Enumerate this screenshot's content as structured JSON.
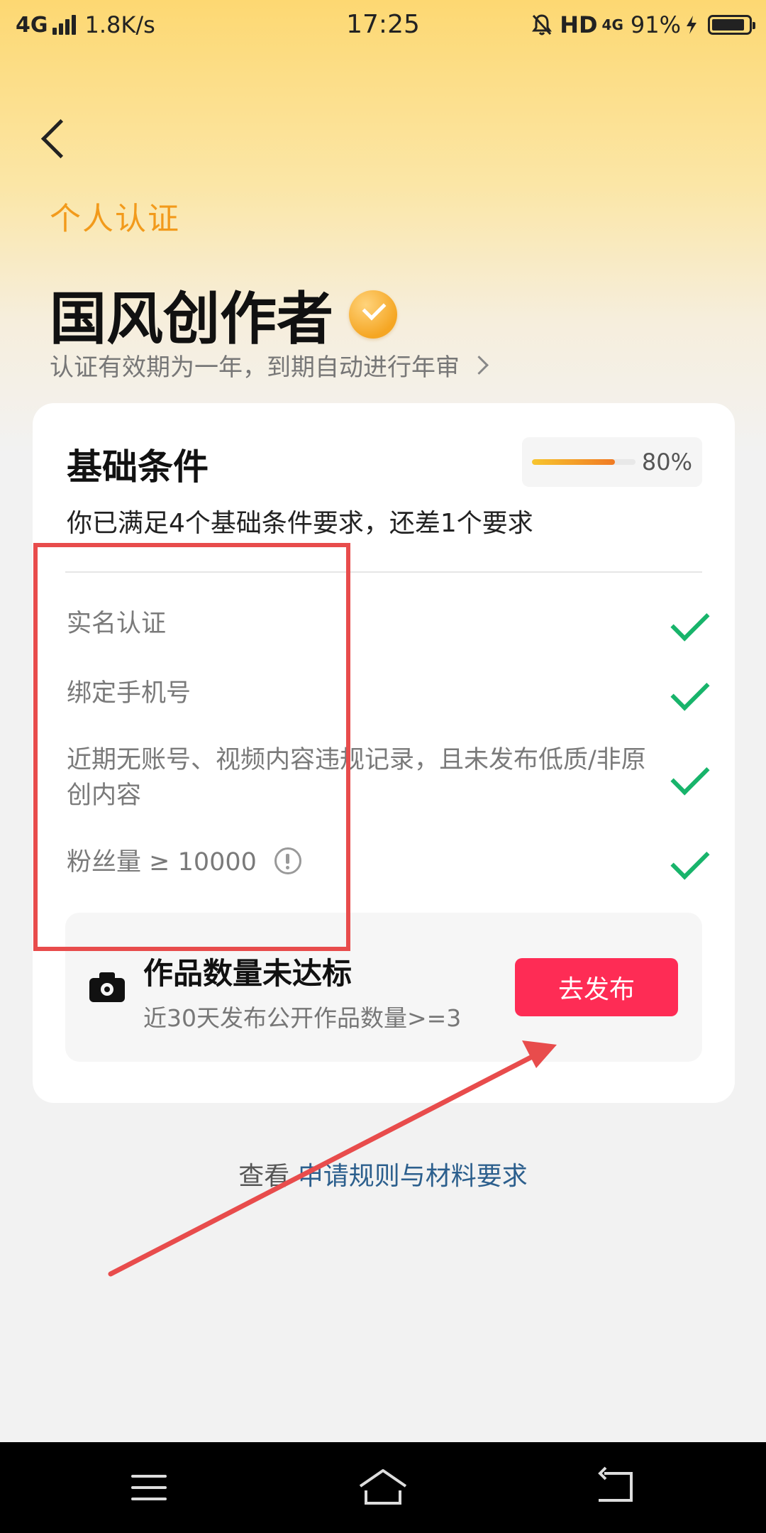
{
  "status_bar": {
    "network": "4G",
    "speed": "1.8K/s",
    "time": "17:25",
    "hd": "HD",
    "net_small": "4G",
    "battery_text": "91%",
    "battery_level": 0.91
  },
  "header": {
    "back_icon": "chevron-left-icon",
    "section_label": "个人认证",
    "title": "国风创作者",
    "verified_icon": "verified-badge-icon",
    "validity_text": "认证有效期为一年，到期自动进行年审"
  },
  "card": {
    "title": "基础条件",
    "progress_text": "80%",
    "progress_value": 0.8,
    "summary": "你已满足4个基础条件要求，还差1个要求",
    "requirements": [
      {
        "label": "实名认证",
        "met": true
      },
      {
        "label": "绑定手机号",
        "met": true
      },
      {
        "label": "近期无账号、视频内容违规记录，且未发布低质/非原创内容",
        "met": true
      },
      {
        "label": "粉丝量 ≥ 10000",
        "met": true
      }
    ],
    "pending": {
      "icon": "camera-icon",
      "title": "作品数量未达标",
      "desc": "近30天发布公开作品数量>=3",
      "button": "去发布"
    }
  },
  "footer": {
    "prefix": "查看 ",
    "link": "申请规则与材料要求"
  },
  "colors": {
    "accent_orange": "#f29a1b",
    "check_green": "#18b46b",
    "button_red": "#fe2c55",
    "annotation_red": "#e84c4c",
    "link_blue": "#2c5f8d"
  }
}
